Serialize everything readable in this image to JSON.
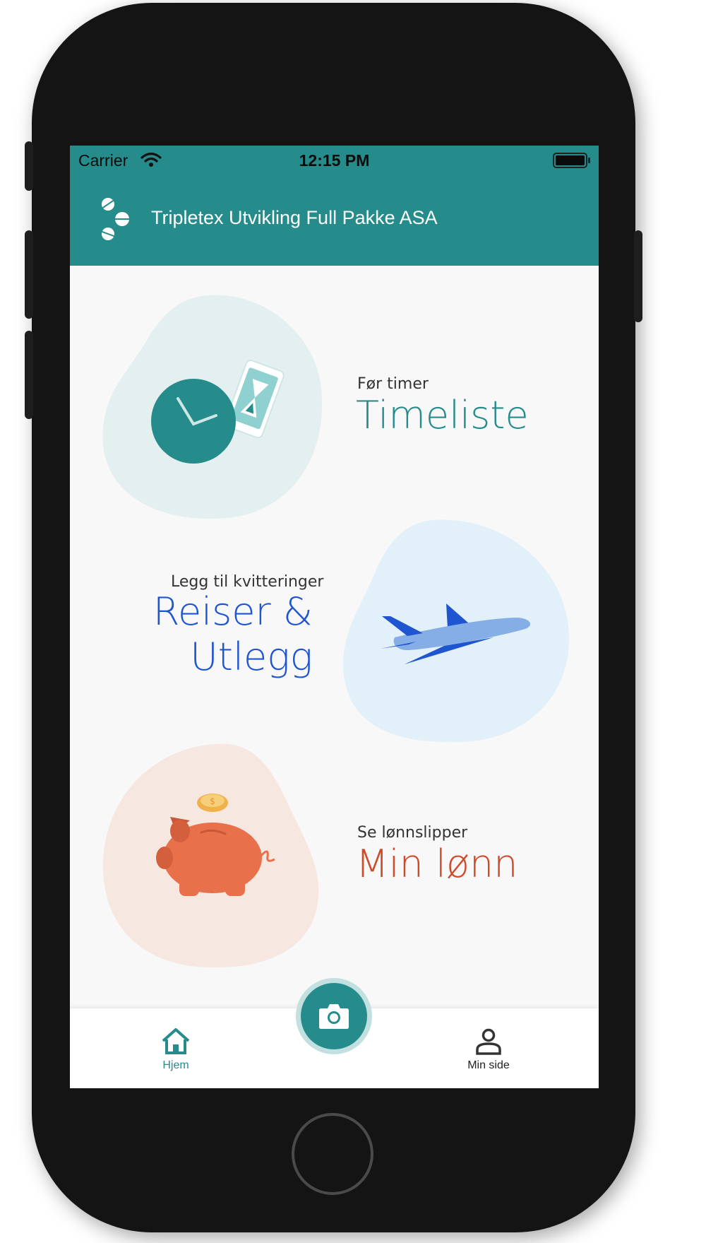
{
  "status_bar": {
    "carrier": "Carrier",
    "time": "12:15 PM"
  },
  "header": {
    "company_name": "Tripletex Utvikling Full Pakke ASA"
  },
  "cards": [
    {
      "subtitle": "Før timer",
      "title": "Timeliste",
      "title_color": "#268b8b",
      "icon": "clock-hourglass-icon"
    },
    {
      "subtitle": "Legg til kvitteringer",
      "title_line1": "Reiser &",
      "title_line2": "Utlegg",
      "title_color": "#1f55d0",
      "icon": "airplane-icon"
    },
    {
      "subtitle": "Se lønnslipper",
      "title": "Min lønn",
      "title_color": "#d04a2a",
      "icon": "piggy-bank-icon"
    }
  ],
  "bottom_nav": {
    "home_label": "Hjem",
    "profile_label": "Min side",
    "active_color": "#268b8b"
  },
  "colors": {
    "brand": "#268b8b"
  }
}
